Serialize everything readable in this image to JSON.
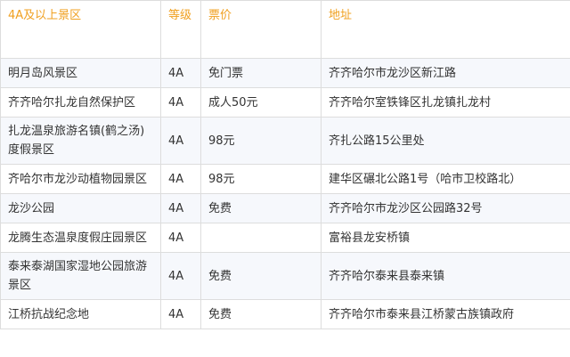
{
  "table": {
    "headers": [
      "4A及以上景区",
      "等级",
      "票价",
      "地址"
    ],
    "rows": [
      [
        "明月岛风景区",
        "4A",
        "免门票",
        "齐齐哈尔市龙沙区新江路"
      ],
      [
        "齐齐哈尔扎龙自然保护区",
        "4A",
        "成人50元",
        "齐齐哈尔室铁锋区扎龙镇扎龙村"
      ],
      [
        "扎龙温泉旅游名镇(鹤之汤)度假景区",
        "4A",
        "98元",
        "齐扎公路15公里处"
      ],
      [
        "齐哈尔市龙沙动植物园景区",
        "4A",
        "98元",
        "建华区碾北公路1号（哈市卫校路北）"
      ],
      [
        "龙沙公园",
        "4A",
        "免费",
        "齐齐哈尔市龙沙区公园路32号"
      ],
      [
        "龙腾生态温泉度假庄园景区",
        "4A",
        "",
        "富裕县龙安桥镇"
      ],
      [
        "泰来泰湖国家湿地公园旅游景区",
        "4A",
        "免费",
        "齐齐哈尔泰来县泰来镇"
      ],
      [
        "江桥抗战纪念地",
        "4A",
        "免费",
        "齐齐哈尔市泰来县江桥蒙古族镇政府"
      ]
    ]
  }
}
